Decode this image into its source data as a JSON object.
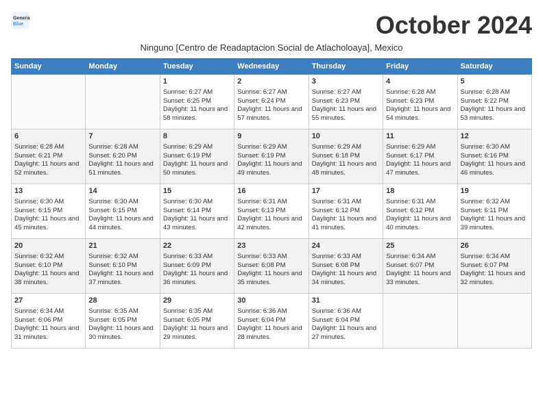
{
  "header": {
    "logo_line1": "General",
    "logo_line2": "Blue",
    "month_title": "October 2024",
    "subtitle": "Ninguno [Centro de Readaptacion Social de Atlacholoaya], Mexico"
  },
  "weekdays": [
    "Sunday",
    "Monday",
    "Tuesday",
    "Wednesday",
    "Thursday",
    "Friday",
    "Saturday"
  ],
  "rows": [
    [
      {
        "day": "",
        "sunrise": "",
        "sunset": "",
        "daylight": "",
        "empty": true
      },
      {
        "day": "",
        "sunrise": "",
        "sunset": "",
        "daylight": "",
        "empty": true
      },
      {
        "day": "1",
        "sunrise": "Sunrise: 6:27 AM",
        "sunset": "Sunset: 6:25 PM",
        "daylight": "Daylight: 11 hours and 58 minutes."
      },
      {
        "day": "2",
        "sunrise": "Sunrise: 6:27 AM",
        "sunset": "Sunset: 6:24 PM",
        "daylight": "Daylight: 11 hours and 57 minutes."
      },
      {
        "day": "3",
        "sunrise": "Sunrise: 6:27 AM",
        "sunset": "Sunset: 6:23 PM",
        "daylight": "Daylight: 11 hours and 55 minutes."
      },
      {
        "day": "4",
        "sunrise": "Sunrise: 6:28 AM",
        "sunset": "Sunset: 6:23 PM",
        "daylight": "Daylight: 11 hours and 54 minutes."
      },
      {
        "day": "5",
        "sunrise": "Sunrise: 6:28 AM",
        "sunset": "Sunset: 6:22 PM",
        "daylight": "Daylight: 11 hours and 53 minutes."
      }
    ],
    [
      {
        "day": "6",
        "sunrise": "Sunrise: 6:28 AM",
        "sunset": "Sunset: 6:21 PM",
        "daylight": "Daylight: 11 hours and 52 minutes."
      },
      {
        "day": "7",
        "sunrise": "Sunrise: 6:28 AM",
        "sunset": "Sunset: 6:20 PM",
        "daylight": "Daylight: 11 hours and 51 minutes."
      },
      {
        "day": "8",
        "sunrise": "Sunrise: 6:29 AM",
        "sunset": "Sunset: 6:19 PM",
        "daylight": "Daylight: 11 hours and 50 minutes."
      },
      {
        "day": "9",
        "sunrise": "Sunrise: 6:29 AM",
        "sunset": "Sunset: 6:19 PM",
        "daylight": "Daylight: 11 hours and 49 minutes."
      },
      {
        "day": "10",
        "sunrise": "Sunrise: 6:29 AM",
        "sunset": "Sunset: 6:18 PM",
        "daylight": "Daylight: 11 hours and 48 minutes."
      },
      {
        "day": "11",
        "sunrise": "Sunrise: 6:29 AM",
        "sunset": "Sunset: 6:17 PM",
        "daylight": "Daylight: 11 hours and 47 minutes."
      },
      {
        "day": "12",
        "sunrise": "Sunrise: 6:30 AM",
        "sunset": "Sunset: 6:16 PM",
        "daylight": "Daylight: 11 hours and 46 minutes."
      }
    ],
    [
      {
        "day": "13",
        "sunrise": "Sunrise: 6:30 AM",
        "sunset": "Sunset: 6:15 PM",
        "daylight": "Daylight: 11 hours and 45 minutes."
      },
      {
        "day": "14",
        "sunrise": "Sunrise: 6:30 AM",
        "sunset": "Sunset: 6:15 PM",
        "daylight": "Daylight: 11 hours and 44 minutes."
      },
      {
        "day": "15",
        "sunrise": "Sunrise: 6:30 AM",
        "sunset": "Sunset: 6:14 PM",
        "daylight": "Daylight: 11 hours and 43 minutes."
      },
      {
        "day": "16",
        "sunrise": "Sunrise: 6:31 AM",
        "sunset": "Sunset: 6:13 PM",
        "daylight": "Daylight: 11 hours and 42 minutes."
      },
      {
        "day": "17",
        "sunrise": "Sunrise: 6:31 AM",
        "sunset": "Sunset: 6:12 PM",
        "daylight": "Daylight: 11 hours and 41 minutes."
      },
      {
        "day": "18",
        "sunrise": "Sunrise: 6:31 AM",
        "sunset": "Sunset: 6:12 PM",
        "daylight": "Daylight: 11 hours and 40 minutes."
      },
      {
        "day": "19",
        "sunrise": "Sunrise: 6:32 AM",
        "sunset": "Sunset: 6:11 PM",
        "daylight": "Daylight: 11 hours and 39 minutes."
      }
    ],
    [
      {
        "day": "20",
        "sunrise": "Sunrise: 6:32 AM",
        "sunset": "Sunset: 6:10 PM",
        "daylight": "Daylight: 11 hours and 38 minutes."
      },
      {
        "day": "21",
        "sunrise": "Sunrise: 6:32 AM",
        "sunset": "Sunset: 6:10 PM",
        "daylight": "Daylight: 11 hours and 37 minutes."
      },
      {
        "day": "22",
        "sunrise": "Sunrise: 6:33 AM",
        "sunset": "Sunset: 6:09 PM",
        "daylight": "Daylight: 11 hours and 36 minutes."
      },
      {
        "day": "23",
        "sunrise": "Sunrise: 6:33 AM",
        "sunset": "Sunset: 6:08 PM",
        "daylight": "Daylight: 11 hours and 35 minutes."
      },
      {
        "day": "24",
        "sunrise": "Sunrise: 6:33 AM",
        "sunset": "Sunset: 6:08 PM",
        "daylight": "Daylight: 11 hours and 34 minutes."
      },
      {
        "day": "25",
        "sunrise": "Sunrise: 6:34 AM",
        "sunset": "Sunset: 6:07 PM",
        "daylight": "Daylight: 11 hours and 33 minutes."
      },
      {
        "day": "26",
        "sunrise": "Sunrise: 6:34 AM",
        "sunset": "Sunset: 6:07 PM",
        "daylight": "Daylight: 11 hours and 32 minutes."
      }
    ],
    [
      {
        "day": "27",
        "sunrise": "Sunrise: 6:34 AM",
        "sunset": "Sunset: 6:06 PM",
        "daylight": "Daylight: 11 hours and 31 minutes."
      },
      {
        "day": "28",
        "sunrise": "Sunrise: 6:35 AM",
        "sunset": "Sunset: 6:05 PM",
        "daylight": "Daylight: 11 hours and 30 minutes."
      },
      {
        "day": "29",
        "sunrise": "Sunrise: 6:35 AM",
        "sunset": "Sunset: 6:05 PM",
        "daylight": "Daylight: 11 hours and 29 minutes."
      },
      {
        "day": "30",
        "sunrise": "Sunrise: 6:36 AM",
        "sunset": "Sunset: 6:04 PM",
        "daylight": "Daylight: 11 hours and 28 minutes."
      },
      {
        "day": "31",
        "sunrise": "Sunrise: 6:36 AM",
        "sunset": "Sunset: 6:04 PM",
        "daylight": "Daylight: 11 hours and 27 minutes."
      },
      {
        "day": "",
        "sunrise": "",
        "sunset": "",
        "daylight": "",
        "empty": true
      },
      {
        "day": "",
        "sunrise": "",
        "sunset": "",
        "daylight": "",
        "empty": true
      }
    ]
  ]
}
